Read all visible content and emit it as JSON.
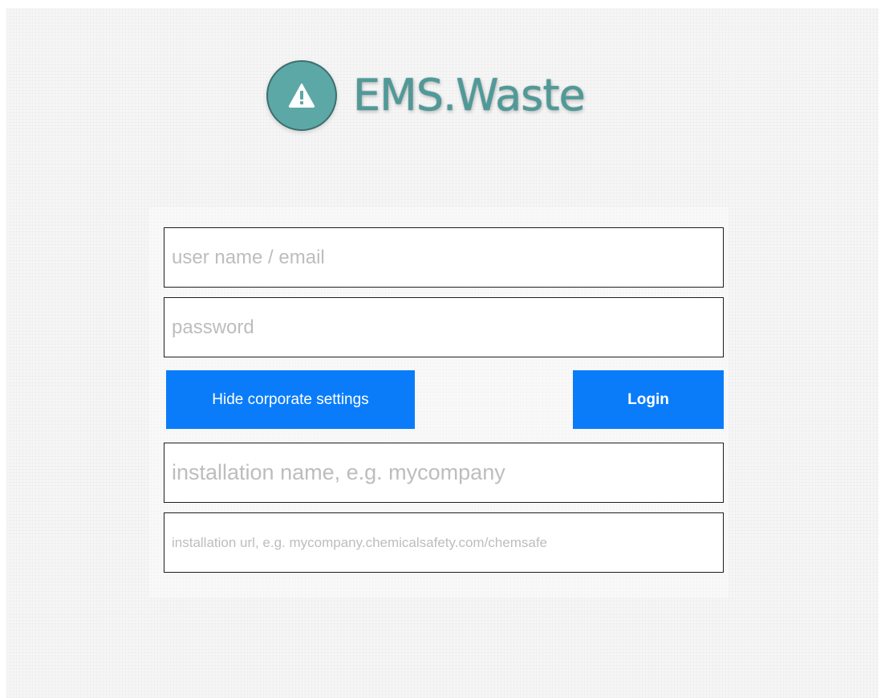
{
  "app": {
    "title": "EMS.Waste",
    "logo_icon": "warning-triangle-icon",
    "logo_color": "#5ca8a7"
  },
  "login_form": {
    "username": {
      "value": "",
      "placeholder": "user name / email"
    },
    "password": {
      "value": "",
      "placeholder": "password"
    },
    "hide_corporate_label": "Hide corporate settings",
    "login_label": "Login",
    "button_color": "#0a7cfa"
  },
  "corporate_settings": {
    "installation_name": {
      "value": "",
      "placeholder": "installation name, e.g. mycompany"
    },
    "installation_url": {
      "value": "",
      "placeholder": "installation url, e.g. mycompany.chemicalsafety.com/chemsafe"
    }
  }
}
